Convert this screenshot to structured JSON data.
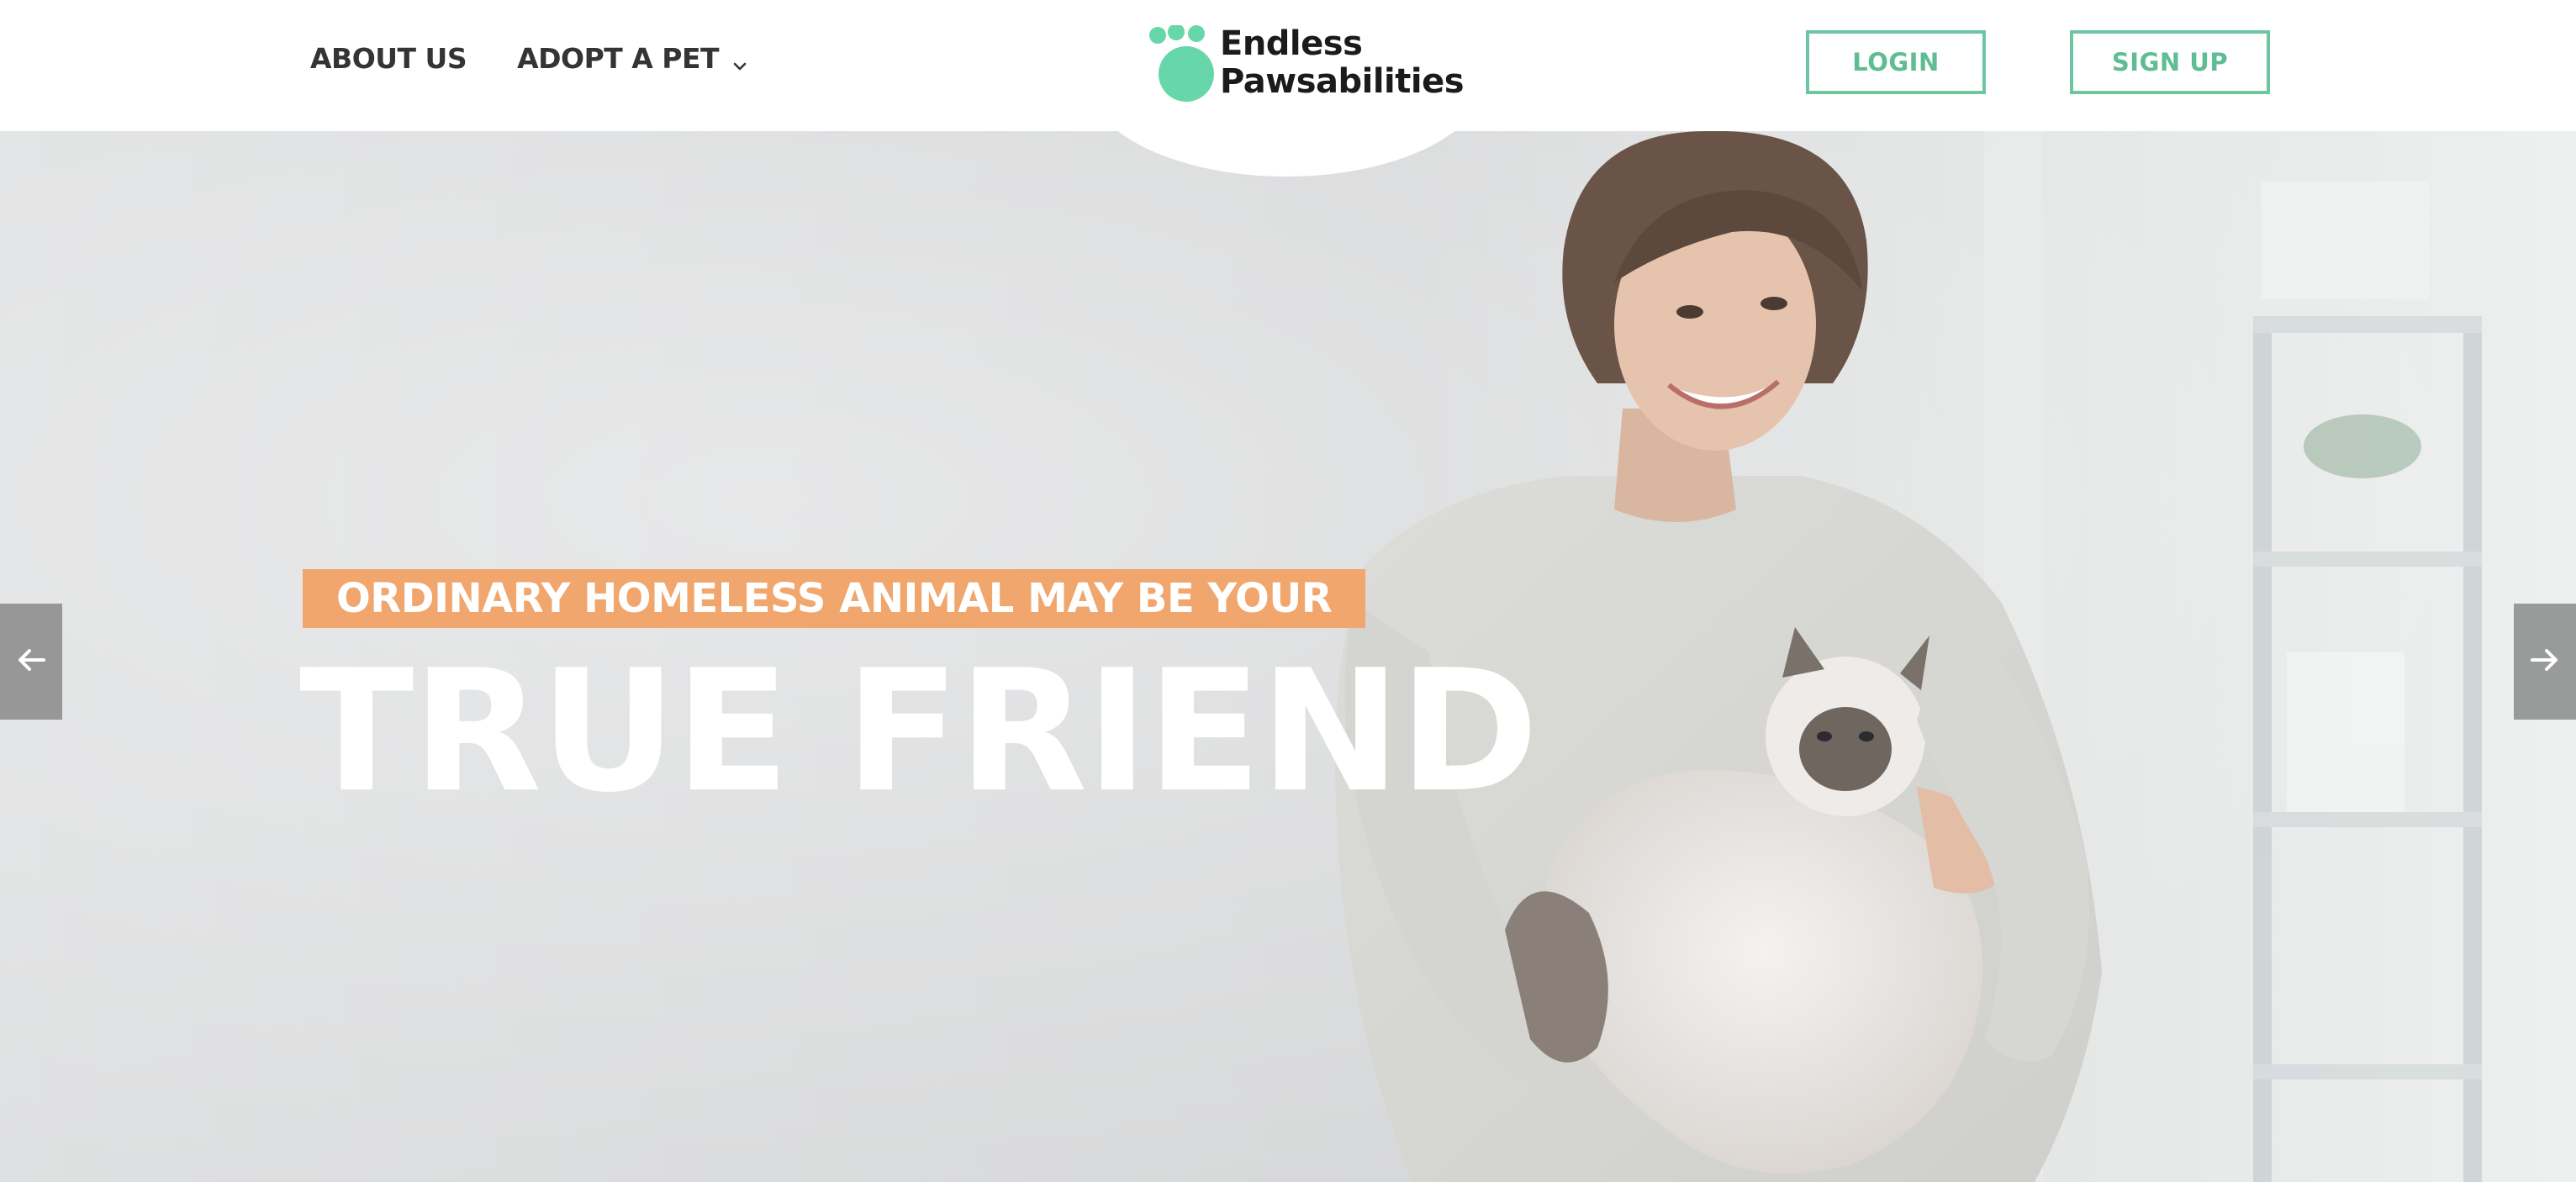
{
  "nav": {
    "items": [
      {
        "label": "ABOUT US"
      },
      {
        "label": "ADOPT A PET",
        "icon": "chevron-down-icon"
      }
    ]
  },
  "logo": {
    "line1": "Endless",
    "line2": "Pawsabilities",
    "icon": "paw-icon",
    "color": "#67d7a9"
  },
  "auth": {
    "login_label": "LOGIN",
    "signup_label": "SIGN UP",
    "accent": "#6cc7a0"
  },
  "hero": {
    "tagline": "ORDINARY HOMELESS ANIMAL MAY BE YOUR",
    "headline": "TRUE FRIEND",
    "tagline_bg": "#f0a66d",
    "image": "woman holding fluffy white cat",
    "prev_icon": "arrow-left-icon",
    "next_icon": "arrow-right-icon"
  }
}
